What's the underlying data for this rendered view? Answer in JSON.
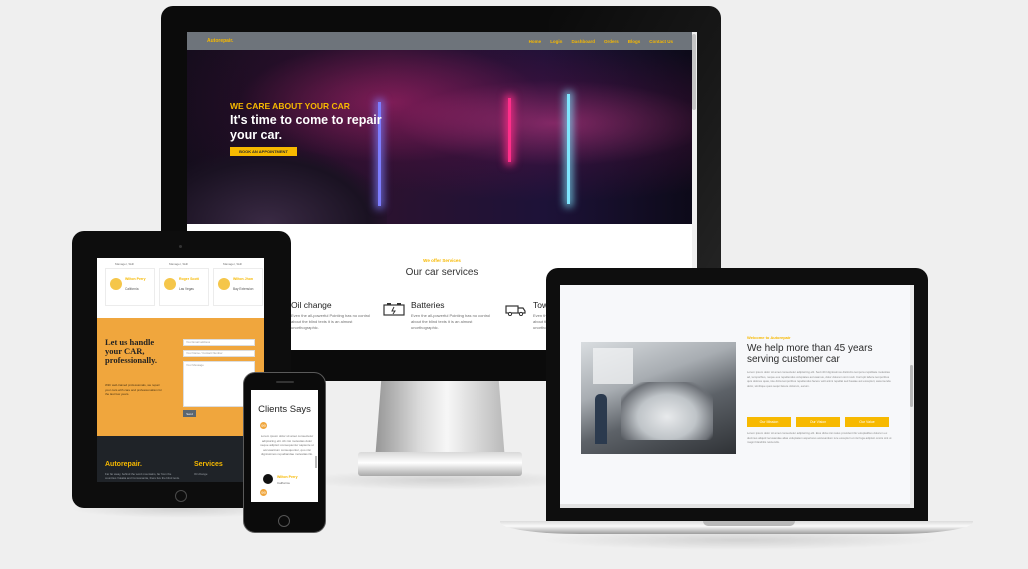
{
  "desktop": {
    "logo": "Autorepair.",
    "nav": [
      "Home",
      "Login",
      "Dashboard",
      "Orders",
      "Blogs",
      "Contact Us"
    ],
    "hero_kicker": "WE CARE ABOUT YOUR CAR",
    "hero_title": "It's time to come to repair your car.",
    "hero_button": "BOOK AN APPOINTMENT",
    "services_kicker": "We offer Services",
    "services_title": "Our car services",
    "services": [
      {
        "name": "Oil change",
        "desc": "Even the all-powerful Pointing has no control about the blind texts it is an almost unorthographic.",
        "icon": "oil-can-icon"
      },
      {
        "name": "Batteries",
        "desc": "Even the all-powerful Pointing has no control about the blind texts it is an almost unorthographic.",
        "icon": "battery-icon"
      },
      {
        "name": "Tow",
        "desc": "Even the all-powerful Pointing has no control about the blind texts it is an almost unorthographic.",
        "icon": "tow-truck-icon"
      }
    ]
  },
  "tablet": {
    "top_heads": [
      "Manager, Skill",
      "Manager, Skill",
      "Manager, Skill"
    ],
    "cards": [
      {
        "name": "Wilton Perry",
        "place": "California"
      },
      {
        "name": "Roger Scott",
        "place": "Las Vegas"
      },
      {
        "name": "Wilton Jhon",
        "place": "Bay Extension"
      }
    ],
    "contact_title": "Let us handle your CAR, professionally.",
    "contact_desc": "With well-trained professionals, we repair your cars with care and professionalism for the last few years.",
    "field_name": "Your Email address",
    "field_phone": "Your Name / Contact Number",
    "field_message": "Your Message",
    "send": "Send",
    "footer_brand": "Autorepair.",
    "footer_services": "Services",
    "footer_desc": "Far far away, behind the word mountains, far from the countries Vokalia and Consonantia, there live the blind texts.",
    "footer_link": "Oil change"
  },
  "phone": {
    "title": "Clients Says",
    "badge": "99",
    "text": "Lorem ipsum dolor sit amet consectetur adipisicing elit. Ab nisi molestias dolor neque adipisci consequuntur sapiente ut accusantium consequuntur, quo nisi dignissimos repudiandae molestias illo.",
    "name": "Wilton Perry",
    "place": "California"
  },
  "laptop": {
    "kicker": "Welcome to Autorepair",
    "title": "We help more than 45 years serving customer car",
    "para": "Lorem ipsum dolor sit amet consectetur adipisicing elit. Sed nihil dignissimos distinctio tempora cupiditate molestias ad, temporibus, neque eos repellendus voluptates accusamus, dolor dolorem sint modi. Corrupti labore temporibus quis dolores quas, iste dicta temporibus repellendus facere velit animi repellat sed beatae aut excepturi, assumenda dolor, similique quos sequi facere dolorum, earum.",
    "buttons": [
      "Our Mission",
      "Our Vision",
      "Our Value"
    ],
    "para2": "Lorem ipsum dolor sit amet consectetur adipisicing elit. Eius dicta nisi natus provident illo voluptatibus dolorum ex ducimus aliquid recusandae alias voluptatem asperiores accusantium iure excepturi et nisi fuga adipisci omnis sint ut magni blanditiis reiciendis."
  },
  "colors": {
    "accent": "#f7b900",
    "orange": "#f0a63d",
    "nav": "#6e747b",
    "footer": "#1f2328"
  }
}
